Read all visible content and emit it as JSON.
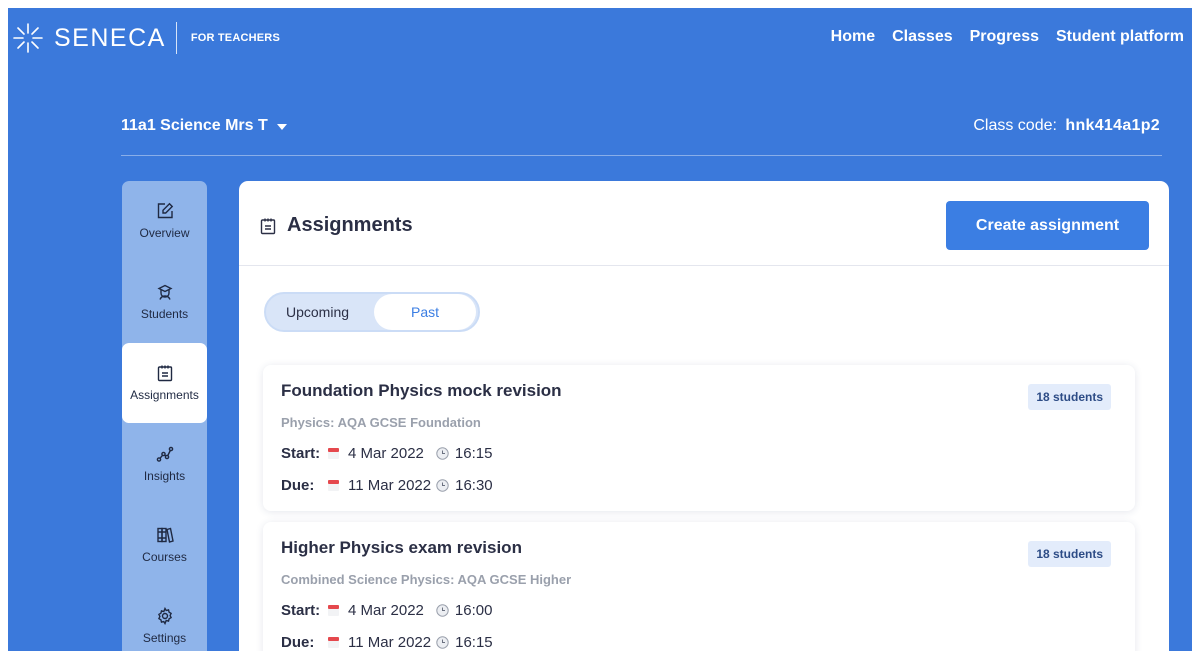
{
  "brand": {
    "name": "SENECA",
    "subtitle": "FOR TEACHERS"
  },
  "topnav": [
    "Home",
    "Classes",
    "Progress",
    "Student platform"
  ],
  "class": {
    "name": "11a1 Science Mrs T",
    "code_label": "Class code:",
    "code": "hnk414a1p2"
  },
  "sidebar": {
    "items": [
      {
        "label": "Overview",
        "icon": "edit-icon"
      },
      {
        "label": "Students",
        "icon": "student-icon"
      },
      {
        "label": "Assignments",
        "icon": "clipboard-icon",
        "active": true
      },
      {
        "label": "Insights",
        "icon": "chart-icon"
      },
      {
        "label": "Courses",
        "icon": "books-icon"
      },
      {
        "label": "Settings",
        "icon": "gear-icon"
      }
    ]
  },
  "main": {
    "title": "Assignments",
    "create_label": "Create assignment",
    "tabs": {
      "upcoming": "Upcoming",
      "past": "Past",
      "selected": "Past"
    },
    "assignments": [
      {
        "title": "Foundation Physics mock revision",
        "course": "Physics: AQA GCSE Foundation",
        "students": "18 students",
        "start_label": "Start:",
        "start_date": "4 Mar 2022",
        "start_time": "16:15",
        "due_label": "Due:",
        "due_date": "11 Mar 2022",
        "due_time": "16:30"
      },
      {
        "title": "Higher Physics exam revision",
        "course": "Combined Science Physics: AQA GCSE Higher",
        "students": "18 students",
        "start_label": "Start:",
        "start_date": "4 Mar 2022",
        "start_time": "16:00",
        "due_label": "Due:",
        "due_date": "11 Mar 2022",
        "due_time": "16:15"
      }
    ]
  },
  "colors": {
    "brand_blue": "#3b79db",
    "rail": "#8fb4ea",
    "button": "#3b7ee3",
    "calendar_red": "#e5484d"
  }
}
